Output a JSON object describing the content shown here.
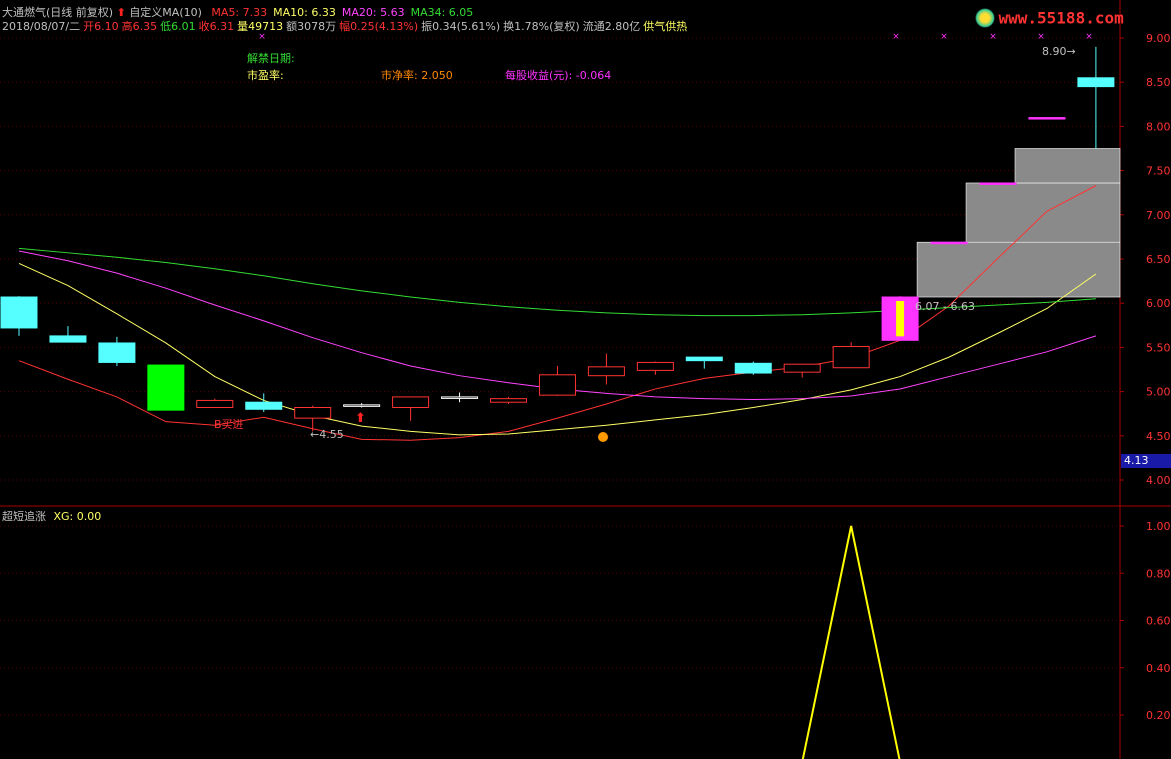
{
  "header": {
    "title": "大通燃气(日线 前复权)",
    "custom_label": "自定义MA(10)",
    "ma_legend": [
      {
        "label": "MA5: 7.33",
        "color": "#ff3333"
      },
      {
        "label": "MA10: 6.33",
        "color": "#ffff66"
      },
      {
        "label": "MA20: 5.63",
        "color": "#ff44ff"
      },
      {
        "label": "MA34: 6.05",
        "color": "#33dd33"
      }
    ],
    "quote_line": [
      {
        "text": "2018/08/07/二",
        "color": "#c0c0c0"
      },
      {
        "text": "开6.10",
        "color": "#ff3333"
      },
      {
        "text": "高6.35",
        "color": "#ff3333"
      },
      {
        "text": "低6.01",
        "color": "#33dd33"
      },
      {
        "text": "收6.31",
        "color": "#ff3333"
      },
      {
        "text": "量49713",
        "color": "#ffff66"
      },
      {
        "text": "额3078万",
        "color": "#c0c0c0"
      },
      {
        "text": "幅0.25(4.13%)",
        "color": "#ff3333"
      },
      {
        "text": "振0.34(5.61%)",
        "color": "#c0c0c0"
      },
      {
        "text": "换1.78%(复权)",
        "color": "#c0c0c0"
      },
      {
        "text": "流通2.80亿",
        "color": "#c0c0c0"
      },
      {
        "text": "供气供热",
        "color": "#ffff66"
      }
    ],
    "watermark": "www.55188.com"
  },
  "info": {
    "unlock_date_label": "解禁日期:",
    "pe_label": "市盈率:",
    "pb_label": "市净率: 2.050",
    "eps_label": "每股收益(元): -0.064"
  },
  "annotations": {
    "buy_label": "B买进",
    "low_label": "←4.55",
    "high_label": "8.90→",
    "range_label": "6.07 - 6.63",
    "price_tag": "4.13"
  },
  "indicator": {
    "title": "超短追涨",
    "value_label": "XG: 0.00"
  },
  "chart_data": [
    {
      "type": "candlestick",
      "y_ticks": [
        "9.00",
        "8.50",
        "8.00",
        "7.50",
        "7.00",
        "6.50",
        "6.00",
        "5.50",
        "5.00",
        "4.50",
        "4.00"
      ],
      "ylim": [
        3.9,
        9.1
      ],
      "candles": [
        {
          "open": 6.07,
          "high": 6.08,
          "low": 5.63,
          "close": 5.72,
          "color": "#55ffff"
        },
        {
          "open": 5.63,
          "high": 5.74,
          "low": 5.56,
          "close": 5.56,
          "color": "#55ffff"
        },
        {
          "open": 5.55,
          "high": 5.62,
          "low": 5.29,
          "close": 5.33,
          "color": "#55ffff"
        },
        {
          "open": 5.3,
          "high": 5.3,
          "low": 4.79,
          "close": 4.79,
          "color": "#00ff00"
        },
        {
          "open": 4.82,
          "high": 4.92,
          "low": 4.82,
          "close": 4.9,
          "color": "#ff3333"
        },
        {
          "open": 4.88,
          "high": 4.98,
          "low": 4.77,
          "close": 4.8,
          "color": "#55ffff"
        },
        {
          "open": 4.7,
          "high": 4.84,
          "low": 4.55,
          "close": 4.82,
          "color": "#ff3333"
        },
        {
          "open": 4.85,
          "high": 4.87,
          "low": 4.82,
          "close": 4.85,
          "color": "#ffffff"
        },
        {
          "open": 4.82,
          "high": 4.94,
          "low": 4.67,
          "close": 4.94,
          "color": "#ff3333"
        },
        {
          "open": 4.94,
          "high": 4.99,
          "low": 4.88,
          "close": 4.93,
          "color": "#ffffff"
        },
        {
          "open": 4.88,
          "high": 4.94,
          "low": 4.86,
          "close": 4.92,
          "color": "#ff3333"
        },
        {
          "open": 4.96,
          "high": 5.29,
          "low": 4.95,
          "close": 5.19,
          "color": "#ff3333"
        },
        {
          "open": 5.18,
          "high": 5.43,
          "low": 5.08,
          "close": 5.28,
          "color": "#ff3333"
        },
        {
          "open": 5.24,
          "high": 5.34,
          "low": 5.19,
          "close": 5.33,
          "color": "#ff3333"
        },
        {
          "open": 5.39,
          "high": 5.39,
          "low": 5.26,
          "close": 5.35,
          "color": "#55ffff"
        },
        {
          "open": 5.32,
          "high": 5.34,
          "low": 5.19,
          "close": 5.21,
          "color": "#55ffff"
        },
        {
          "open": 5.22,
          "high": 5.31,
          "low": 5.16,
          "close": 5.31,
          "color": "#ff3333"
        },
        {
          "open": 5.27,
          "high": 5.56,
          "low": 5.27,
          "close": 5.51,
          "color": "#ff3333"
        },
        {
          "open": 5.58,
          "high": 6.08,
          "low": 5.58,
          "close": 6.07,
          "color": "#ff33ff"
        },
        {
          "open": 6.69,
          "high": 6.69,
          "low": 6.69,
          "close": 6.69,
          "color": "#ff33ff"
        },
        {
          "open": 7.36,
          "high": 7.36,
          "low": 7.36,
          "close": 7.36,
          "color": "#ff33ff"
        },
        {
          "open": 8.1,
          "high": 8.1,
          "low": 8.1,
          "close": 8.1,
          "color": "#ff33ff"
        },
        {
          "open": 8.55,
          "high": 8.9,
          "low": 7.75,
          "close": 8.45,
          "color": "#55ffff"
        }
      ],
      "ma_lines": [
        {
          "name": "MA5",
          "color": "#ff3333",
          "values": [
            5.35,
            5.14,
            4.94,
            4.66,
            4.62,
            4.71,
            4.58,
            4.46,
            4.45,
            4.48,
            4.55,
            4.7,
            4.86,
            5.03,
            5.15,
            5.22,
            5.28,
            5.38,
            5.58,
            5.97,
            6.51,
            7.04,
            7.33
          ]
        },
        {
          "name": "MA10",
          "color": "#ffff66",
          "values": [
            6.45,
            6.2,
            5.88,
            5.55,
            5.17,
            4.9,
            4.73,
            4.61,
            4.55,
            4.51,
            4.52,
            4.57,
            4.62,
            4.68,
            4.74,
            4.82,
            4.91,
            5.02,
            5.17,
            5.39,
            5.66,
            5.94,
            6.33
          ]
        },
        {
          "name": "MA20",
          "color": "#ff44ff",
          "values": [
            6.59,
            6.48,
            6.34,
            6.17,
            5.98,
            5.8,
            5.61,
            5.44,
            5.29,
            5.18,
            5.1,
            5.03,
            4.98,
            4.94,
            4.92,
            4.91,
            4.92,
            4.95,
            5.03,
            5.17,
            5.31,
            5.45,
            5.63
          ]
        },
        {
          "name": "MA34",
          "color": "#33dd33",
          "values": [
            6.62,
            6.57,
            6.52,
            6.46,
            6.39,
            6.31,
            6.22,
            6.14,
            6.07,
            6.01,
            5.96,
            5.92,
            5.89,
            5.87,
            5.86,
            5.86,
            5.87,
            5.89,
            5.92,
            5.95,
            5.98,
            6.01,
            6.05
          ]
        }
      ],
      "resistance_boxes": [
        {
          "from_index": 18,
          "top": 6.69,
          "bottom": 6.07
        },
        {
          "from_index": 19,
          "top": 7.36,
          "bottom": 6.69
        },
        {
          "from_index": 20,
          "top": 7.75,
          "bottom": 7.36
        }
      ]
    },
    {
      "type": "line",
      "title": "超短追涨",
      "y_ticks": [
        "1.00",
        "0.80",
        "0.60",
        "0.40",
        "0.20"
      ],
      "ylim": [
        0,
        1.08
      ],
      "series": [
        {
          "name": "XG",
          "color": "#ffff00",
          "values": [
            0,
            0,
            0,
            0,
            0,
            0,
            0,
            0,
            0,
            0,
            0,
            0,
            0,
            0,
            0,
            0,
            0,
            1,
            0,
            0,
            0,
            0,
            0.0
          ]
        }
      ]
    }
  ]
}
